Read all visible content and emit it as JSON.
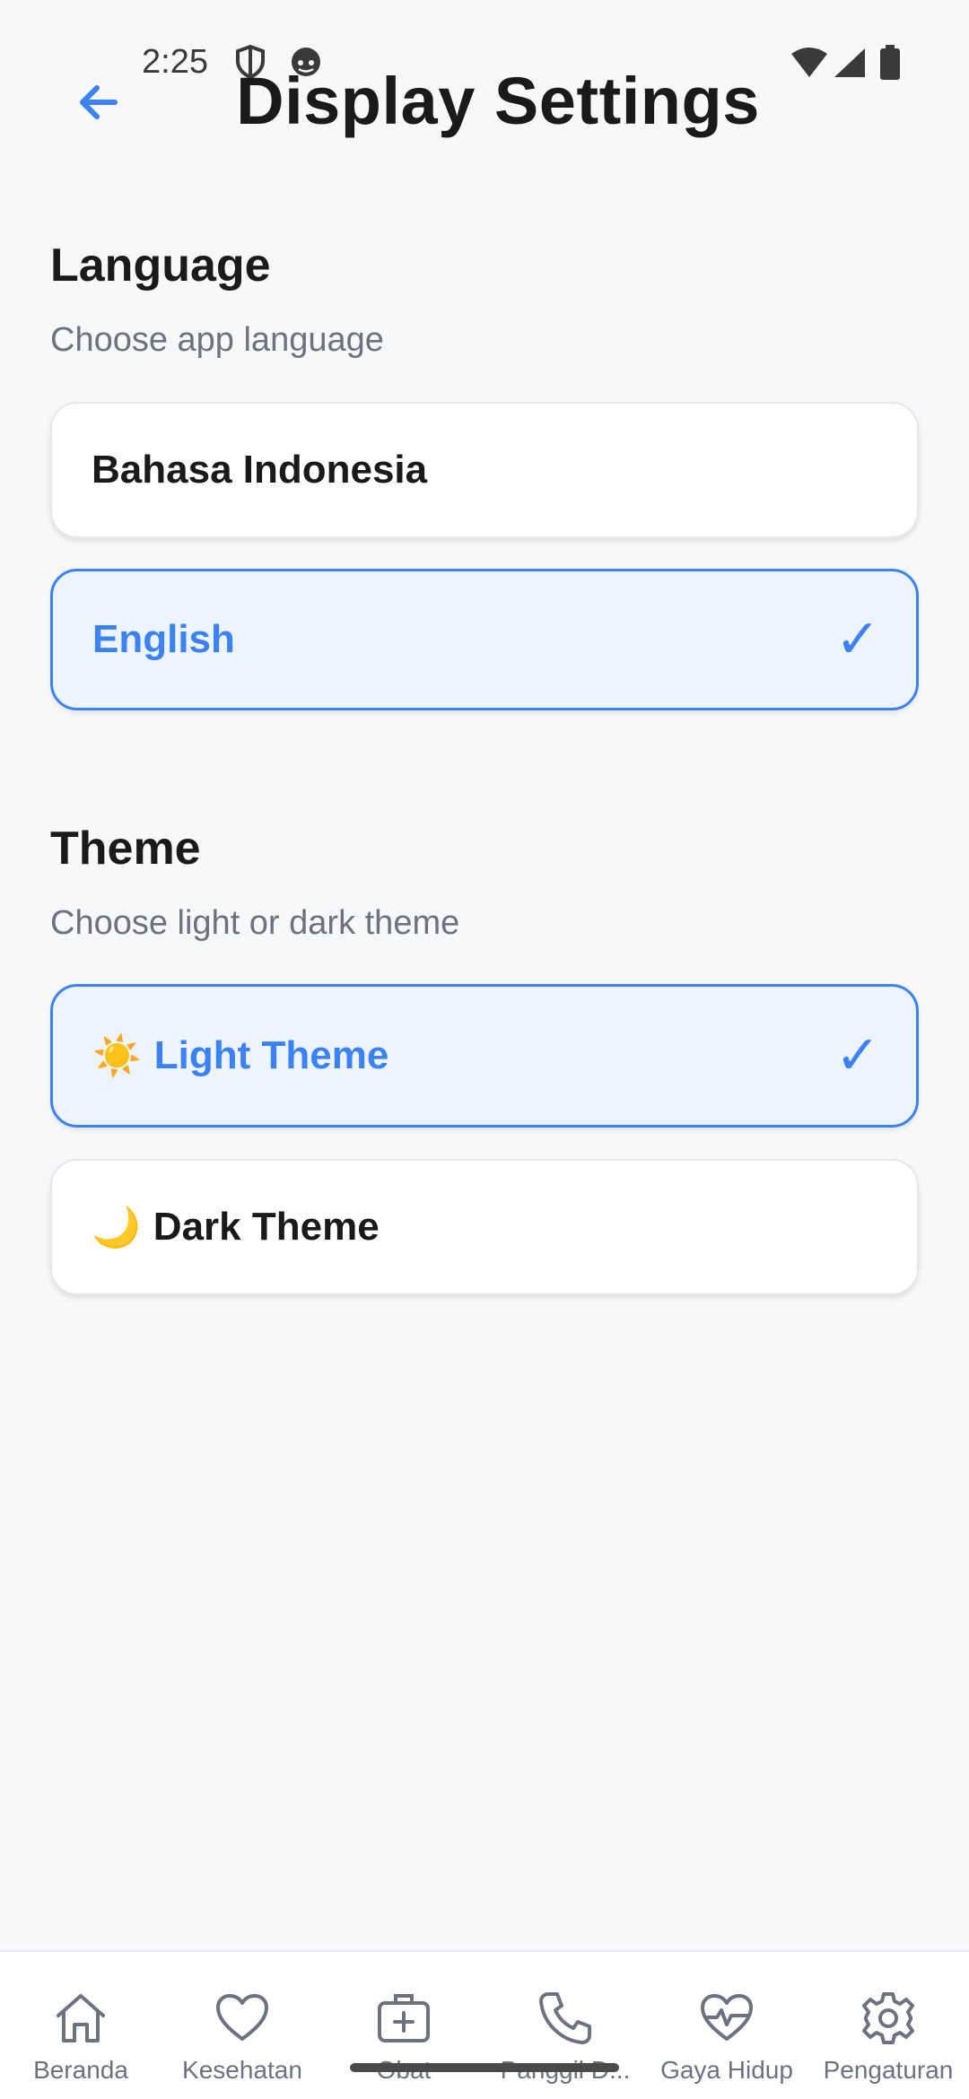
{
  "status_bar": {
    "time": "2:25"
  },
  "header": {
    "title": "Display Settings"
  },
  "language": {
    "title": "Language",
    "subtitle": "Choose app language",
    "options": [
      {
        "label": "Bahasa Indonesia",
        "selected": false
      },
      {
        "label": "English",
        "selected": true
      }
    ]
  },
  "theme": {
    "title": "Theme",
    "subtitle": "Choose light or dark theme",
    "options": [
      {
        "emoji": "☀️",
        "label": "Light Theme",
        "selected": true
      },
      {
        "emoji": "🌙",
        "label": "Dark Theme",
        "selected": false
      }
    ]
  },
  "check_glyph": "✓",
  "bottom_nav": [
    {
      "label": "Beranda",
      "icon": "home-icon"
    },
    {
      "label": "Kesehatan",
      "icon": "heart-icon"
    },
    {
      "label": "Obat",
      "icon": "medical-kit-icon"
    },
    {
      "label": "Panggil D...",
      "icon": "phone-icon"
    },
    {
      "label": "Gaya Hidup",
      "icon": "heart-pulse-icon"
    },
    {
      "label": "Pengaturan",
      "icon": "gear-icon"
    }
  ],
  "colors": {
    "accent": "#3B82F6",
    "background": "#F7F8FA",
    "selected_background": "#EEF4FE",
    "muted_text": "#6B7280"
  }
}
